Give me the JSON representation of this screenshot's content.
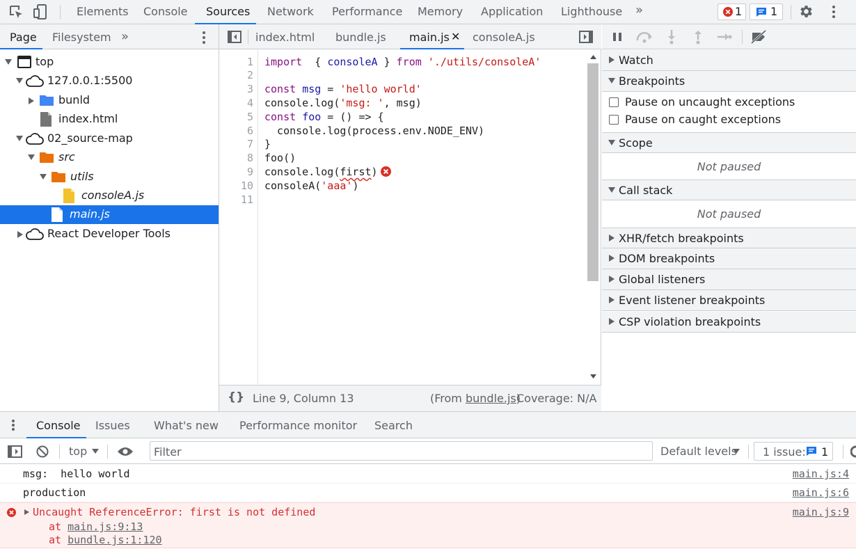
{
  "main_tabs": [
    "Elements",
    "Console",
    "Sources",
    "Network",
    "Performance",
    "Memory",
    "Application",
    "Lighthouse"
  ],
  "main_tabs_active": "Sources",
  "more_tabs": "»",
  "error_count": "1",
  "message_count": "1",
  "navigator": {
    "tabs": [
      "Page",
      "Filesystem"
    ],
    "more": "»",
    "tree": [
      {
        "label": "top"
      },
      {
        "label": "127.0.0.1:5500"
      },
      {
        "label": "bunld"
      },
      {
        "label": "index.html"
      },
      {
        "label": "02_source-map"
      },
      {
        "label": "src"
      },
      {
        "label": "utils"
      },
      {
        "label": "consoleA.js"
      },
      {
        "label": "main.js"
      },
      {
        "label": "React Developer Tools"
      }
    ]
  },
  "editor": {
    "tabs": [
      "index.html",
      "bundle.js",
      "main.js",
      "consoleA.js"
    ],
    "active_tab": "main.js",
    "close_glyph": "✕",
    "line_numbers": [
      "1",
      "2",
      "3",
      "4",
      "5",
      "6",
      "7",
      "8",
      "9",
      "10",
      "11"
    ],
    "status": {
      "braces": "{}",
      "position": "Line 9, Column 13",
      "from_prefix": "(From ",
      "from_file": "bundle.js",
      "from_suffix": ")",
      "coverage": "Coverage: N/A"
    }
  },
  "debugger": {
    "sections": {
      "watch": "Watch",
      "breakpoints": "Breakpoints",
      "pause_uncaught": "Pause on uncaught exceptions",
      "pause_caught": "Pause on caught exceptions",
      "scope": "Scope",
      "scope_placeholder": "Not paused",
      "call_stack": "Call stack",
      "call_stack_placeholder": "Not paused",
      "xhr": "XHR/fetch breakpoints",
      "dom": "DOM breakpoints",
      "global": "Global listeners",
      "event": "Event listener breakpoints",
      "csp": "CSP violation breakpoints"
    }
  },
  "drawer": {
    "tabs": [
      "Console",
      "Issues",
      "What's new",
      "Performance monitor",
      "Search"
    ],
    "active_tab": "Console",
    "context": "top",
    "filter_placeholder": "Filter",
    "levels": "Default levels",
    "issues_label": "1 issue:",
    "issues_count": "1",
    "messages": [
      {
        "text": "msg:  hello world",
        "source": "main.js:4"
      },
      {
        "text": "production",
        "source": "main.js:6"
      }
    ],
    "error": {
      "text": "Uncaught ReferenceError: first is not defined",
      "source": "main.js:9",
      "stack_prefix": "at ",
      "stack": [
        "main.js:9:13",
        "bundle.js:1:120"
      ]
    }
  },
  "colors": {
    "accent": "#1a73e8",
    "error": "#d93025",
    "keyword": "#881280",
    "string": "#c41a16",
    "variable": "#1a1aa6"
  }
}
